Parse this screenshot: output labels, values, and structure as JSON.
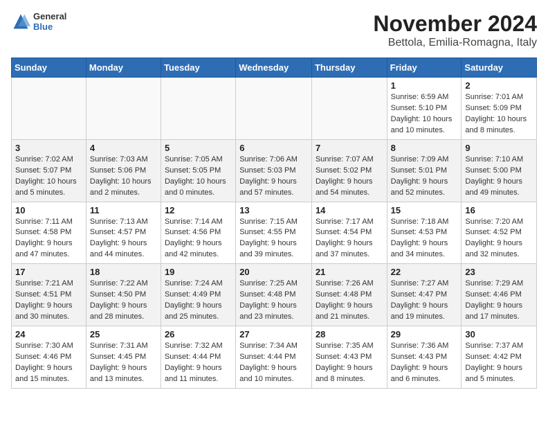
{
  "header": {
    "logo": {
      "general": "General",
      "blue": "Blue"
    },
    "month": "November 2024",
    "location": "Bettola, Emilia-Romagna, Italy"
  },
  "days_of_week": [
    "Sunday",
    "Monday",
    "Tuesday",
    "Wednesday",
    "Thursday",
    "Friday",
    "Saturday"
  ],
  "weeks": [
    {
      "shaded": false,
      "days": [
        {
          "num": "",
          "info": ""
        },
        {
          "num": "",
          "info": ""
        },
        {
          "num": "",
          "info": ""
        },
        {
          "num": "",
          "info": ""
        },
        {
          "num": "",
          "info": ""
        },
        {
          "num": "1",
          "info": "Sunrise: 6:59 AM\nSunset: 5:10 PM\nDaylight: 10 hours\nand 10 minutes."
        },
        {
          "num": "2",
          "info": "Sunrise: 7:01 AM\nSunset: 5:09 PM\nDaylight: 10 hours\nand 8 minutes."
        }
      ]
    },
    {
      "shaded": true,
      "days": [
        {
          "num": "3",
          "info": "Sunrise: 7:02 AM\nSunset: 5:07 PM\nDaylight: 10 hours\nand 5 minutes."
        },
        {
          "num": "4",
          "info": "Sunrise: 7:03 AM\nSunset: 5:06 PM\nDaylight: 10 hours\nand 2 minutes."
        },
        {
          "num": "5",
          "info": "Sunrise: 7:05 AM\nSunset: 5:05 PM\nDaylight: 10 hours\nand 0 minutes."
        },
        {
          "num": "6",
          "info": "Sunrise: 7:06 AM\nSunset: 5:03 PM\nDaylight: 9 hours\nand 57 minutes."
        },
        {
          "num": "7",
          "info": "Sunrise: 7:07 AM\nSunset: 5:02 PM\nDaylight: 9 hours\nand 54 minutes."
        },
        {
          "num": "8",
          "info": "Sunrise: 7:09 AM\nSunset: 5:01 PM\nDaylight: 9 hours\nand 52 minutes."
        },
        {
          "num": "9",
          "info": "Sunrise: 7:10 AM\nSunset: 5:00 PM\nDaylight: 9 hours\nand 49 minutes."
        }
      ]
    },
    {
      "shaded": false,
      "days": [
        {
          "num": "10",
          "info": "Sunrise: 7:11 AM\nSunset: 4:58 PM\nDaylight: 9 hours\nand 47 minutes."
        },
        {
          "num": "11",
          "info": "Sunrise: 7:13 AM\nSunset: 4:57 PM\nDaylight: 9 hours\nand 44 minutes."
        },
        {
          "num": "12",
          "info": "Sunrise: 7:14 AM\nSunset: 4:56 PM\nDaylight: 9 hours\nand 42 minutes."
        },
        {
          "num": "13",
          "info": "Sunrise: 7:15 AM\nSunset: 4:55 PM\nDaylight: 9 hours\nand 39 minutes."
        },
        {
          "num": "14",
          "info": "Sunrise: 7:17 AM\nSunset: 4:54 PM\nDaylight: 9 hours\nand 37 minutes."
        },
        {
          "num": "15",
          "info": "Sunrise: 7:18 AM\nSunset: 4:53 PM\nDaylight: 9 hours\nand 34 minutes."
        },
        {
          "num": "16",
          "info": "Sunrise: 7:20 AM\nSunset: 4:52 PM\nDaylight: 9 hours\nand 32 minutes."
        }
      ]
    },
    {
      "shaded": true,
      "days": [
        {
          "num": "17",
          "info": "Sunrise: 7:21 AM\nSunset: 4:51 PM\nDaylight: 9 hours\nand 30 minutes."
        },
        {
          "num": "18",
          "info": "Sunrise: 7:22 AM\nSunset: 4:50 PM\nDaylight: 9 hours\nand 28 minutes."
        },
        {
          "num": "19",
          "info": "Sunrise: 7:24 AM\nSunset: 4:49 PM\nDaylight: 9 hours\nand 25 minutes."
        },
        {
          "num": "20",
          "info": "Sunrise: 7:25 AM\nSunset: 4:48 PM\nDaylight: 9 hours\nand 23 minutes."
        },
        {
          "num": "21",
          "info": "Sunrise: 7:26 AM\nSunset: 4:48 PM\nDaylight: 9 hours\nand 21 minutes."
        },
        {
          "num": "22",
          "info": "Sunrise: 7:27 AM\nSunset: 4:47 PM\nDaylight: 9 hours\nand 19 minutes."
        },
        {
          "num": "23",
          "info": "Sunrise: 7:29 AM\nSunset: 4:46 PM\nDaylight: 9 hours\nand 17 minutes."
        }
      ]
    },
    {
      "shaded": false,
      "days": [
        {
          "num": "24",
          "info": "Sunrise: 7:30 AM\nSunset: 4:46 PM\nDaylight: 9 hours\nand 15 minutes."
        },
        {
          "num": "25",
          "info": "Sunrise: 7:31 AM\nSunset: 4:45 PM\nDaylight: 9 hours\nand 13 minutes."
        },
        {
          "num": "26",
          "info": "Sunrise: 7:32 AM\nSunset: 4:44 PM\nDaylight: 9 hours\nand 11 minutes."
        },
        {
          "num": "27",
          "info": "Sunrise: 7:34 AM\nSunset: 4:44 PM\nDaylight: 9 hours\nand 10 minutes."
        },
        {
          "num": "28",
          "info": "Sunrise: 7:35 AM\nSunset: 4:43 PM\nDaylight: 9 hours\nand 8 minutes."
        },
        {
          "num": "29",
          "info": "Sunrise: 7:36 AM\nSunset: 4:43 PM\nDaylight: 9 hours\nand 6 minutes."
        },
        {
          "num": "30",
          "info": "Sunrise: 7:37 AM\nSunset: 4:42 PM\nDaylight: 9 hours\nand 5 minutes."
        }
      ]
    }
  ]
}
